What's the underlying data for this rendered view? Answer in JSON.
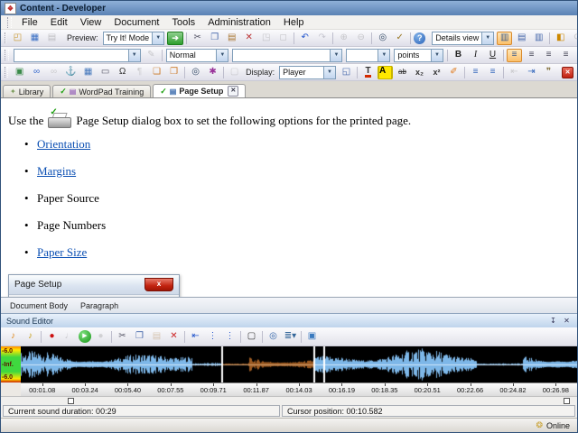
{
  "window": {
    "title": "Content - Developer"
  },
  "menubar": {
    "items": [
      "File",
      "Edit",
      "View",
      "Document",
      "Tools",
      "Administration",
      "Help"
    ]
  },
  "toolbar1": {
    "preview_label": "Preview:",
    "preview_value": "Try It! Mode",
    "details_view_value": "Details view",
    "icons_file": [
      {
        "name": "open-folder-icon",
        "glyph": "◰",
        "color": "#c8962a"
      },
      {
        "name": "save-icon",
        "glyph": "▦",
        "color": "#3a6fc4"
      },
      {
        "name": "print-icon",
        "glyph": "▤",
        "color": "#666",
        "disabled": true
      }
    ],
    "icons_edit": [
      {
        "name": "go-preview-icon",
        "glyph": "➔",
        "shape": "green-btn"
      },
      {
        "name": "cut-icon",
        "glyph": "✂",
        "color": "#556",
        "sep": true
      },
      {
        "name": "copy-icon",
        "glyph": "❐",
        "color": "#4466aa"
      },
      {
        "name": "paste-icon",
        "glyph": "▤",
        "color": "#aa7733"
      },
      {
        "name": "delete-icon",
        "glyph": "✕",
        "color": "#bb3333"
      },
      {
        "name": "properties-doc-icon",
        "glyph": "◳",
        "color": "#777",
        "disabled": true
      },
      {
        "name": "clear-icon",
        "glyph": "◻",
        "color": "#777",
        "disabled": true
      },
      {
        "name": "undo-icon",
        "glyph": "↶",
        "color": "#2255cc",
        "sep": true
      },
      {
        "name": "redo-icon",
        "glyph": "↷",
        "color": "#778",
        "disabled": true
      },
      {
        "name": "zoom-in-icon",
        "glyph": "⊕",
        "color": "#777",
        "disabled": true,
        "sep": true
      },
      {
        "name": "zoom-out-icon",
        "glyph": "⊖",
        "color": "#777",
        "disabled": true
      },
      {
        "name": "find-icon",
        "glyph": "◎",
        "color": "#334a66",
        "sep": true
      },
      {
        "name": "spellcheck-icon",
        "glyph": "✓",
        "color": "#997722"
      },
      {
        "name": "help-icon",
        "glyph": "?",
        "shape": "circle-blue",
        "sep": true
      }
    ],
    "icons_view": [
      {
        "name": "details-view-icon",
        "glyph": "▥",
        "color": "#3a5a8a",
        "hl": true
      },
      {
        "name": "split-view-icon",
        "glyph": "▤",
        "color": "#4466aa"
      },
      {
        "name": "two-pane-view-icon",
        "glyph": "▥",
        "color": "#4466aa"
      },
      {
        "name": "folder-properties-icon",
        "glyph": "◧",
        "color": "#cc8800",
        "sep": true
      },
      {
        "name": "refresh-icon",
        "glyph": "⟳",
        "color": "#777",
        "disabled": true
      }
    ]
  },
  "toolbar2": {
    "style_value": "",
    "format_value": "Normal",
    "font_value": "",
    "size_value": "",
    "units_value": "points",
    "icons_paint": [
      {
        "name": "format-painter-icon",
        "glyph": "✎",
        "color": "#777",
        "disabled": true
      }
    ],
    "icons_text": [
      {
        "name": "bold-icon",
        "glyph": "B",
        "color": "#222",
        "sep": true
      },
      {
        "name": "italic-icon",
        "glyph": "I",
        "color": "#222"
      },
      {
        "name": "underline-icon",
        "glyph": "U",
        "color": "#222"
      },
      {
        "name": "align-left-icon",
        "glyph": "≡",
        "color": "#3a5a8a",
        "hl": true,
        "sep": true
      },
      {
        "name": "align-center-icon",
        "glyph": "≡",
        "color": "#445"
      },
      {
        "name": "align-right-icon",
        "glyph": "≡",
        "color": "#445"
      },
      {
        "name": "align-justify-icon",
        "glyph": "≡",
        "color": "#445"
      }
    ]
  },
  "toolbar3": {
    "display_label": "Display:",
    "display_value": "Player",
    "icons_insert": [
      {
        "name": "insert-image-icon",
        "glyph": "▣",
        "color": "#3a8a4a"
      },
      {
        "name": "hyperlink-icon",
        "glyph": "∞",
        "color": "#3366cc"
      },
      {
        "name": "remove-link-icon",
        "glyph": "∞",
        "color": "#888",
        "disabled": true
      },
      {
        "name": "anchor-icon",
        "glyph": "⚓",
        "color": "#445566"
      },
      {
        "name": "insert-table-icon",
        "glyph": "▦",
        "color": "#4477bb"
      },
      {
        "name": "horizontal-rule-icon",
        "glyph": "▭",
        "color": "#556"
      },
      {
        "name": "special-character-icon",
        "glyph": "Ω",
        "color": "#333"
      },
      {
        "name": "line-break-icon",
        "glyph": "¶",
        "color": "#888",
        "disabled": true
      },
      {
        "name": "bookmark-icon",
        "glyph": "❏",
        "color": "#cc7722"
      },
      {
        "name": "bookmark-list-icon",
        "glyph": "❐",
        "color": "#cc7722"
      },
      {
        "name": "find-text-icon",
        "glyph": "◎",
        "color": "#334a66",
        "sep": true
      },
      {
        "name": "replace-icon",
        "glyph": "✱",
        "color": "#993399"
      },
      {
        "name": "locked-doc-icon",
        "glyph": "▢",
        "color": "#888",
        "disabled": true,
        "sep": true
      }
    ],
    "icons_window": [
      {
        "name": "display-window-icon",
        "glyph": "◱",
        "color": "#4466aa"
      }
    ],
    "icons_format": [
      {
        "name": "font-color-icon",
        "glyph": "T",
        "color": "#333",
        "sep": true
      },
      {
        "name": "highlight-icon",
        "glyph": "A",
        "color": "#000"
      },
      {
        "name": "strikethrough-icon",
        "glyph": "ab",
        "color": "#333"
      },
      {
        "name": "subscript-icon",
        "glyph": "x₂",
        "color": "#333"
      },
      {
        "name": "superscript-icon",
        "glyph": "x²",
        "color": "#333"
      },
      {
        "name": "eraser-icon",
        "glyph": "✐",
        "color": "#e07818"
      },
      {
        "name": "numbered-list-icon",
        "glyph": "≡",
        "color": "#3366bb",
        "sep": true
      },
      {
        "name": "bullet-list-icon",
        "glyph": "≡",
        "color": "#3366bb"
      },
      {
        "name": "decrease-indent-icon",
        "glyph": "⇤",
        "color": "#888",
        "disabled": true,
        "sep": true
      },
      {
        "name": "increase-indent-icon",
        "glyph": "⇥",
        "color": "#3366bb"
      },
      {
        "name": "blockquote-icon",
        "glyph": "❞",
        "color": "#887744"
      },
      {
        "name": "line-spacing-icon",
        "glyph": "⇕",
        "color": "#334a66"
      }
    ],
    "close_glyph": "✕"
  },
  "tabbar": {
    "tabs": [
      {
        "label": "Library"
      },
      {
        "label": "WordPad Training"
      },
      {
        "label": "Page Setup"
      }
    ],
    "close_glyph": "✕",
    "check_glyph": "✓"
  },
  "doc": {
    "intro_prefix": "Use the",
    "intro_suffix": "Page Setup dialog box to set the following options for the printed page.",
    "bullets": [
      {
        "label": "Orientation",
        "link": true
      },
      {
        "label": "Margins",
        "link": true
      },
      {
        "label": "Paper Source",
        "link": false
      },
      {
        "label": "Page Numbers",
        "link": false
      },
      {
        "label": "Paper Size",
        "link": true
      }
    ],
    "dialog": {
      "title": "Page Setup",
      "close_glyph": "x"
    }
  },
  "pathbar": {
    "items": [
      "Document Body",
      "Paragraph"
    ]
  },
  "sound_editor": {
    "title": "Sound Editor",
    "pin_glyph": "↧",
    "close_glyph": "✕",
    "icons": [
      {
        "name": "new-sound-icon",
        "glyph": "♪",
        "color": "#e08818"
      },
      {
        "name": "open-sound-icon",
        "glyph": "♪",
        "color": "#c8a018"
      },
      {
        "name": "record-icon",
        "glyph": "●",
        "color": "#cc1111",
        "sep": true
      },
      {
        "name": "record-device-icon",
        "glyph": "♩",
        "color": "#777",
        "disabled": true
      },
      {
        "name": "play-icon",
        "glyph": "▶",
        "shape": "circle-green"
      },
      {
        "name": "stop-icon",
        "glyph": "●",
        "color": "#999",
        "disabled": true
      },
      {
        "name": "cut-sound-icon",
        "glyph": "✂",
        "color": "#556",
        "sep": true
      },
      {
        "name": "copy-sound-icon",
        "glyph": "❐",
        "color": "#4466aa"
      },
      {
        "name": "paste-sound-icon",
        "glyph": "▤",
        "color": "#aa7733",
        "disabled": true
      },
      {
        "name": "delete-sound-icon",
        "glyph": "✕",
        "color": "#cc2222"
      },
      {
        "name": "selection-start-icon",
        "glyph": "⇤",
        "color": "#2255cc",
        "sep": true
      },
      {
        "name": "cursor-marker-icon",
        "glyph": "⋮",
        "color": "#2255cc"
      },
      {
        "name": "selection-end-icon",
        "glyph": "⋮",
        "color": "#2255cc"
      },
      {
        "name": "crop-icon",
        "glyph": "▢",
        "color": "#333",
        "sep": true
      },
      {
        "name": "zoom-wave-icon",
        "glyph": "◎",
        "color": "#3366aa",
        "sep": true
      },
      {
        "name": "view-options-icon",
        "glyph": "≣▾",
        "color": "#336699"
      },
      {
        "name": "waveform-picture-icon",
        "glyph": "▣",
        "color": "#3a7abf",
        "sep": true
      }
    ],
    "scale_labels": [
      "-6.0",
      "-Inf.",
      "-6.0"
    ],
    "timeline": [
      "00:01.08",
      "00:03.24",
      "00:05.40",
      "00:07.55",
      "00:09.71",
      "00:11.87",
      "00:14.03",
      "00:16.19",
      "00:18.35",
      "00:20.51",
      "00:22.66",
      "00:24.82",
      "00:26.98"
    ],
    "wave": {
      "bg": "#000000",
      "separator_color": "#ffffff",
      "separators": [
        0.362,
        0.527,
        0.545
      ],
      "segments": [
        {
          "from": 0,
          "to": 0.362,
          "color": "#7db7e8",
          "center": "#cfe6f8",
          "scale": 1
        },
        {
          "from": 0.362,
          "to": 0.527,
          "color": "#9c5a22",
          "center": "#d0a070",
          "scale": 0.6
        },
        {
          "from": 0.527,
          "to": 1,
          "color": "#7db7e8",
          "center": "#cfe6f8",
          "scale": 1
        }
      ]
    },
    "status": {
      "duration": "Current sound duration: 00:29",
      "cursor": "Cursor position: 00:10.582"
    }
  },
  "bottombar": {
    "online_label": "Online",
    "online_glyph": "❂"
  }
}
